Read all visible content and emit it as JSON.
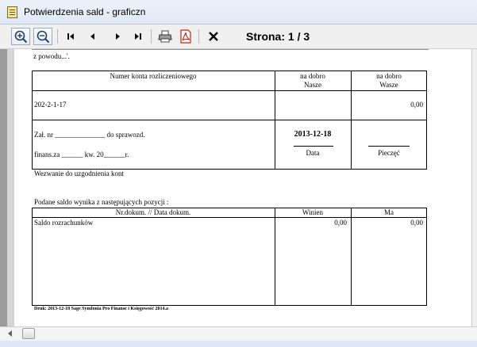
{
  "window": {
    "title": "Potwierdzenia sald - graficzn"
  },
  "toolbar": {
    "buttons": [
      {
        "name": "zoom-in-icon"
      },
      {
        "name": "zoom-out-icon"
      },
      {
        "name": "first-page-icon"
      },
      {
        "name": "previous-page-icon"
      },
      {
        "name": "next-page-icon"
      },
      {
        "name": "last-page-icon"
      },
      {
        "name": "print-icon"
      },
      {
        "name": "pdf-export-icon"
      },
      {
        "name": "close-icon"
      }
    ],
    "page_label": "Strona: 1 / 3"
  },
  "document": {
    "top_fragment": "z powodu...'.",
    "table1": {
      "header_account": "Numer konta rozliczeniowego",
      "header_ours_1": "na dobro",
      "header_ours_2": "Nasze",
      "header_yours_1": "na dobro",
      "header_yours_2": "Wasze",
      "account_number": "202-2-1-17",
      "amount_yours": "0,00",
      "zal_line": "Zał. nr ______________ do sprawozd.",
      "finans_line": "finans.za ______ kw.  20______r.",
      "date_value": "2013-12-18",
      "date_label": "Data",
      "stamp_label": "Pieczęć"
    },
    "wezwanie": "Wezwanie do uzgodnienia kont",
    "podane": "Podane saldo wynika z następujących pozycji :",
    "table2": {
      "header_doc": "Nr.dokum.  // Data dokum.",
      "header_winien": "Winien",
      "header_ma": "Ma",
      "row_label": "Saldo rozrachunków",
      "row_winien": "0,00",
      "row_ma": "0,00"
    },
    "footer": "Druk: 2013-12-18 Sage Symfonia Pro Finanse i Księgowość 2014.a"
  },
  "colors": {
    "titlebar": "#dfe8f4",
    "toolbar": "#f0f0f0",
    "gutter": "#9b9b9b"
  }
}
